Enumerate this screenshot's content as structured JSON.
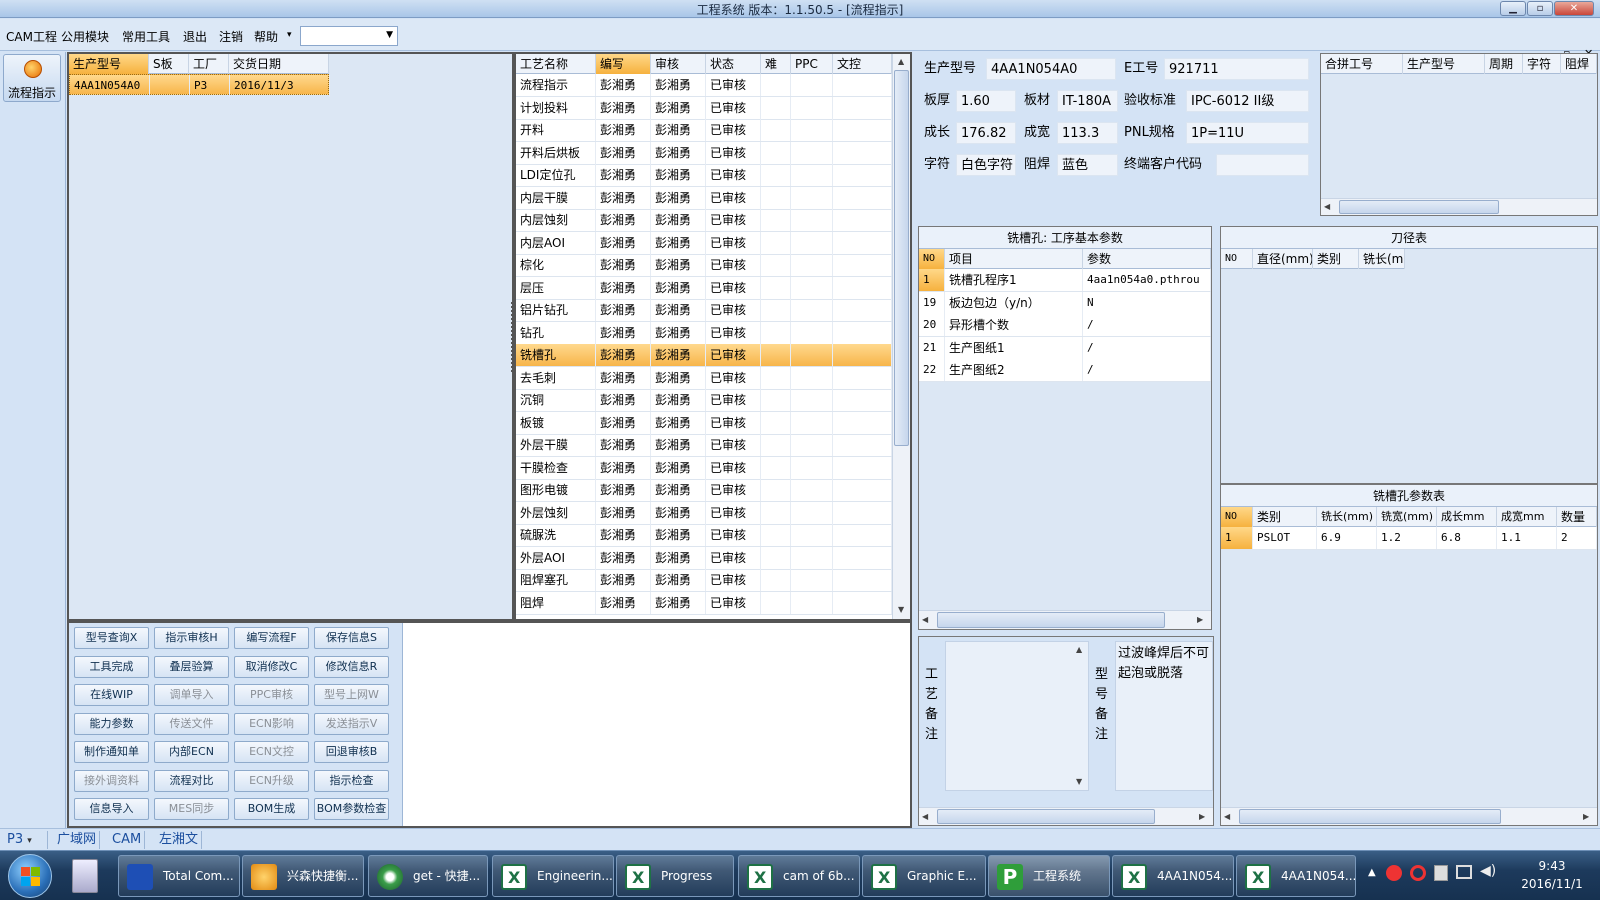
{
  "window": {
    "title": "工程系统   版本：1.1.50.5 - [流程指示]"
  },
  "menu": {
    "items": [
      "CAM工程",
      "公用模块",
      "常用工具",
      "退出",
      "注销",
      "帮助"
    ],
    "combo_value": ""
  },
  "left": {
    "flow_button": "流程指示"
  },
  "orders": {
    "headers": [
      "生产型号",
      "S板",
      "工厂",
      "交货日期"
    ],
    "rows": [
      {
        "model": "4AA1N054A0",
        "s": "",
        "factory": "P3",
        "date": "2016/11/3"
      }
    ]
  },
  "process": {
    "headers": [
      "工艺名称",
      "编写",
      "审核",
      "状态",
      "难",
      "PPC",
      "文控"
    ],
    "rows": [
      {
        "name": "流程指示",
        "writer": "彭湘勇",
        "reviewer": "彭湘勇",
        "status": "已审核"
      },
      {
        "name": "计划投料",
        "writer": "彭湘勇",
        "reviewer": "彭湘勇",
        "status": "已审核"
      },
      {
        "name": "开料",
        "writer": "彭湘勇",
        "reviewer": "彭湘勇",
        "status": "已审核"
      },
      {
        "name": "开料后烘板",
        "writer": "彭湘勇",
        "reviewer": "彭湘勇",
        "status": "已审核"
      },
      {
        "name": "LDI定位孔",
        "writer": "彭湘勇",
        "reviewer": "彭湘勇",
        "status": "已审核"
      },
      {
        "name": "内层干膜",
        "writer": "彭湘勇",
        "reviewer": "彭湘勇",
        "status": "已审核"
      },
      {
        "name": "内层蚀刻",
        "writer": "彭湘勇",
        "reviewer": "彭湘勇",
        "status": "已审核"
      },
      {
        "name": "内层AOI",
        "writer": "彭湘勇",
        "reviewer": "彭湘勇",
        "status": "已审核"
      },
      {
        "name": "棕化",
        "writer": "彭湘勇",
        "reviewer": "彭湘勇",
        "status": "已审核"
      },
      {
        "name": "层压",
        "writer": "彭湘勇",
        "reviewer": "彭湘勇",
        "status": "已审核"
      },
      {
        "name": "铝片钻孔",
        "writer": "彭湘勇",
        "reviewer": "彭湘勇",
        "status": "已审核"
      },
      {
        "name": "钻孔",
        "writer": "彭湘勇",
        "reviewer": "彭湘勇",
        "status": "已审核"
      },
      {
        "name": "铣槽孔",
        "writer": "彭湘勇",
        "reviewer": "彭湘勇",
        "status": "已审核"
      },
      {
        "name": "去毛刺",
        "writer": "彭湘勇",
        "reviewer": "彭湘勇",
        "status": "已审核"
      },
      {
        "name": "沉铜",
        "writer": "彭湘勇",
        "reviewer": "彭湘勇",
        "status": "已审核"
      },
      {
        "name": "板镀",
        "writer": "彭湘勇",
        "reviewer": "彭湘勇",
        "status": "已审核"
      },
      {
        "name": "外层干膜",
        "writer": "彭湘勇",
        "reviewer": "彭湘勇",
        "status": "已审核"
      },
      {
        "name": "干膜检查",
        "writer": "彭湘勇",
        "reviewer": "彭湘勇",
        "status": "已审核"
      },
      {
        "name": "图形电镀",
        "writer": "彭湘勇",
        "reviewer": "彭湘勇",
        "status": "已审核"
      },
      {
        "name": "外层蚀刻",
        "writer": "彭湘勇",
        "reviewer": "彭湘勇",
        "status": "已审核"
      },
      {
        "name": "硫脲洗",
        "writer": "彭湘勇",
        "reviewer": "彭湘勇",
        "status": "已审核"
      },
      {
        "name": "外层AOI",
        "writer": "彭湘勇",
        "reviewer": "彭湘勇",
        "status": "已审核"
      },
      {
        "name": "阻焊塞孔",
        "writer": "彭湘勇",
        "reviewer": "彭湘勇",
        "status": "已审核"
      },
      {
        "name": "阻焊",
        "writer": "彭湘勇",
        "reviewer": "彭湘勇",
        "status": "已审核"
      }
    ]
  },
  "buttons": [
    {
      "label": "型号查询X",
      "enabled": true
    },
    {
      "label": "指示审核H",
      "enabled": true
    },
    {
      "label": "编写流程F",
      "enabled": true
    },
    {
      "label": "保存信息S",
      "enabled": true
    },
    {
      "label": "工具完成",
      "enabled": true
    },
    {
      "label": "叠层验算",
      "enabled": true
    },
    {
      "label": "取消修改C",
      "enabled": true
    },
    {
      "label": "修改信息R",
      "enabled": true
    },
    {
      "label": "在线WIP",
      "enabled": true
    },
    {
      "label": "调单导入",
      "enabled": false
    },
    {
      "label": "PPC审核",
      "enabled": false
    },
    {
      "label": "型号上网W",
      "enabled": false
    },
    {
      "label": "能力参数",
      "enabled": true
    },
    {
      "label": "传送文件",
      "enabled": false
    },
    {
      "label": "ECN影响",
      "enabled": false
    },
    {
      "label": "发送指示V",
      "enabled": false
    },
    {
      "label": "制作通知单",
      "enabled": true
    },
    {
      "label": "内部ECN",
      "enabled": true
    },
    {
      "label": "ECN文控",
      "enabled": false
    },
    {
      "label": "回退审核B",
      "enabled": true
    },
    {
      "label": "接外调资料",
      "enabled": false
    },
    {
      "label": "流程对比",
      "enabled": true
    },
    {
      "label": "ECN升级",
      "enabled": false
    },
    {
      "label": "指示检查",
      "enabled": true
    },
    {
      "label": "信息导入",
      "enabled": true
    },
    {
      "label": "MES同步",
      "enabled": false
    },
    {
      "label": "BOM生成",
      "enabled": true
    },
    {
      "label": "BOM参数检查",
      "enabled": true
    }
  ],
  "info": {
    "labels": {
      "model": "生产型号",
      "e_no": "E工号",
      "thickness": "板厚",
      "material": "板材",
      "standard": "验收标准",
      "length": "成长",
      "width": "成宽",
      "pnl": "PNL规格",
      "char": "字符",
      "mask": "阻焊",
      "customer": "终端客户代码"
    },
    "values": {
      "model": "4AA1N054A0",
      "e_no": "921711",
      "thickness": "1.60",
      "material": "IT-180A",
      "standard": "IPC-6012 II级",
      "length": "176.82",
      "width": "113.3",
      "pnl": "1P=11U",
      "char": "白色字符",
      "mask": "蓝色",
      "customer": ""
    }
  },
  "merge": {
    "headers": [
      "合拼工号",
      "生产型号",
      "周期",
      "字符",
      "阻焊"
    ]
  },
  "params": {
    "title": "铣槽孔: 工序基本参数",
    "headers": [
      "NO",
      "项目",
      "参数"
    ],
    "rows": [
      {
        "no": "1",
        "item": "铣槽孔程序1",
        "value": "4aa1n054a0.pthrou"
      },
      {
        "no": "19",
        "item": "板边包边（y/n）",
        "value": "N"
      },
      {
        "no": "20",
        "item": "异形槽个数",
        "value": "/"
      },
      {
        "no": "21",
        "item": "生产图纸1",
        "value": "/"
      },
      {
        "no": "22",
        "item": "生产图纸2",
        "value": "/"
      }
    ]
  },
  "tools": {
    "title": "刀径表",
    "headers": [
      "NO",
      "直径(mm)",
      "类别",
      "铣长(m)"
    ]
  },
  "slot": {
    "title": "铣槽孔参数表",
    "headers": [
      "NO",
      "类别",
      "铣长(mm)",
      "铣宽(mm)",
      "成长mm",
      "成宽mm",
      "数量"
    ],
    "rows": [
      {
        "no": "1",
        "type": "PSLOT",
        "ml": "6.9",
        "mw": "1.2",
        "len": "6.8",
        "wid": "1.1",
        "qty": "2"
      }
    ]
  },
  "notes": {
    "process_label": "工艺备注",
    "model_label": "型号备注",
    "model_text": "过波峰焊后不可起泡或脱落"
  },
  "status": {
    "factory": "P3",
    "tabs": [
      "广域网",
      "CAM",
      "左湘文"
    ]
  },
  "taskbar": {
    "items": [
      "Total Com...",
      "兴森快捷衡...",
      "get - 快捷...",
      "Engineerin...",
      "Progress",
      "cam of 6b...",
      "Graphic E...",
      "工程系统",
      "4AA1N054...",
      "4AA1N054..."
    ],
    "time": "9:43",
    "date": "2016/11/1"
  }
}
